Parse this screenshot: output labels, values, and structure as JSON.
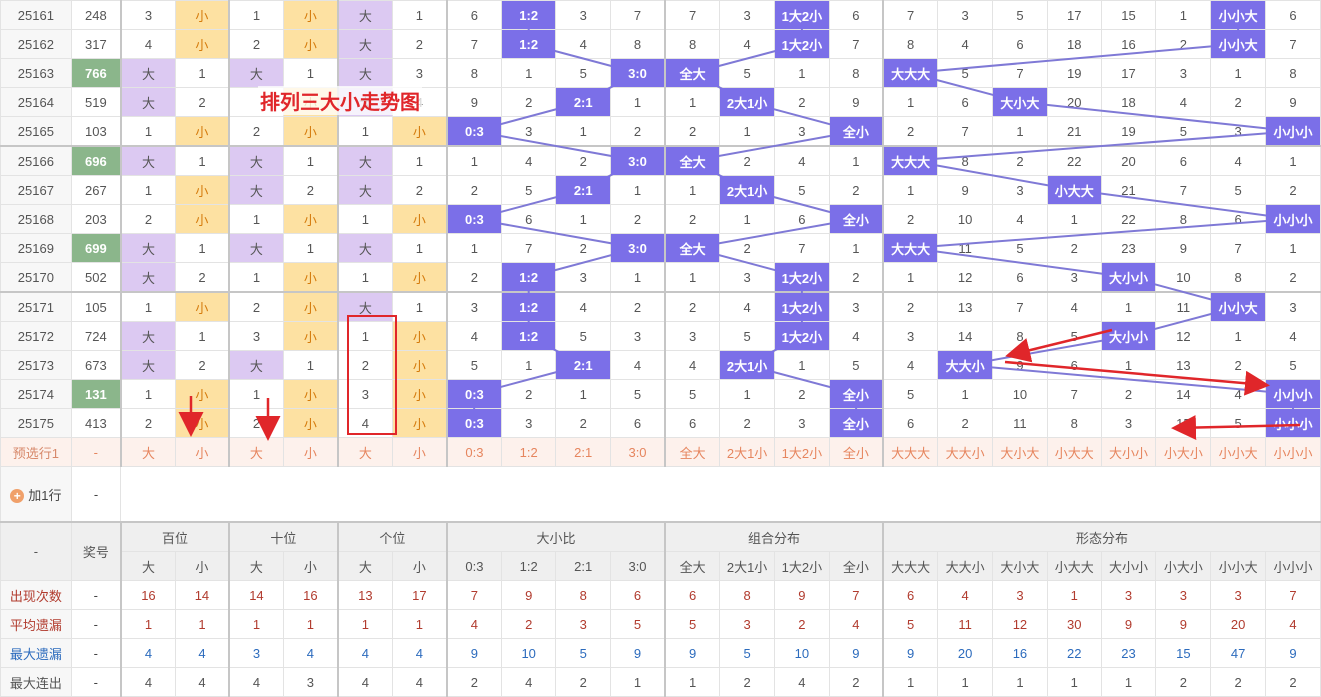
{
  "rows": [
    {
      "issue": "25161",
      "prize": "248",
      "hl": false,
      "cells": [
        "3",
        "小",
        "1",
        "小",
        "大",
        "1",
        "6",
        "1:2",
        "3",
        "7",
        "7",
        "3",
        "1大2小",
        "6",
        "7",
        "3",
        "5",
        "17",
        "15",
        "1",
        "小小大",
        "6"
      ],
      "sel": [
        1,
        3,
        4,
        7,
        12,
        20
      ]
    },
    {
      "issue": "25162",
      "prize": "317",
      "hl": false,
      "cells": [
        "4",
        "小",
        "2",
        "小",
        "大",
        "2",
        "7",
        "1:2",
        "4",
        "8",
        "8",
        "4",
        "1大2小",
        "7",
        "8",
        "4",
        "6",
        "18",
        "16",
        "2",
        "小小大",
        "7"
      ],
      "sel": [
        1,
        3,
        4,
        7,
        12,
        20
      ]
    },
    {
      "issue": "25163",
      "prize": "766",
      "hl": true,
      "cells": [
        "大",
        "1",
        "大",
        "1",
        "大",
        "3",
        "8",
        "1",
        "5",
        "3:0",
        "全大",
        "5",
        "1",
        "8",
        "大大大",
        "5",
        "7",
        "19",
        "17",
        "3",
        "1",
        "8"
      ],
      "sel": [
        0,
        2,
        4,
        9,
        10,
        14
      ]
    },
    {
      "issue": "25164",
      "prize": "519",
      "hl": false,
      "cells": [
        "大",
        "2",
        "",
        "小",
        "大",
        "4",
        "9",
        "2",
        "2:1",
        "1",
        "1",
        "2大1小",
        "2",
        "9",
        "1",
        "6",
        "大小大",
        "20",
        "18",
        "4",
        "2",
        "9"
      ],
      "sel": [
        0,
        3,
        4,
        8,
        11,
        16
      ]
    },
    {
      "issue": "25165",
      "prize": "103",
      "hl": false,
      "cells": [
        "1",
        "小",
        "2",
        "小",
        "1",
        "小",
        "0:3",
        "3",
        "1",
        "2",
        "2",
        "1",
        "3",
        "全小",
        "2",
        "7",
        "1",
        "21",
        "19",
        "5",
        "3",
        "小小小"
      ],
      "sel": [
        1,
        3,
        5,
        6,
        13,
        21
      ]
    },
    {
      "issue": "25166",
      "prize": "696",
      "hl": true,
      "cells": [
        "大",
        "1",
        "大",
        "1",
        "大",
        "1",
        "1",
        "4",
        "2",
        "3:0",
        "全大",
        "2",
        "4",
        "1",
        "大大大",
        "8",
        "2",
        "22",
        "20",
        "6",
        "4",
        "1"
      ],
      "sel": [
        0,
        2,
        4,
        9,
        10,
        14
      ]
    },
    {
      "issue": "25167",
      "prize": "267",
      "hl": false,
      "cells": [
        "1",
        "小",
        "大",
        "2",
        "大",
        "2",
        "2",
        "5",
        "2:1",
        "1",
        "1",
        "2大1小",
        "5",
        "2",
        "1",
        "9",
        "3",
        "小大大",
        "21",
        "7",
        "5",
        "2"
      ],
      "sel": [
        1,
        2,
        4,
        8,
        11,
        17
      ]
    },
    {
      "issue": "25168",
      "prize": "203",
      "hl": false,
      "cells": [
        "2",
        "小",
        "1",
        "小",
        "1",
        "小",
        "0:3",
        "6",
        "1",
        "2",
        "2",
        "1",
        "6",
        "全小",
        "2",
        "10",
        "4",
        "1",
        "22",
        "8",
        "6",
        "小小小"
      ],
      "sel": [
        1,
        3,
        5,
        6,
        13,
        21
      ]
    },
    {
      "issue": "25169",
      "prize": "699",
      "hl": true,
      "cells": [
        "大",
        "1",
        "大",
        "1",
        "大",
        "1",
        "1",
        "7",
        "2",
        "3:0",
        "全大",
        "2",
        "7",
        "1",
        "大大大",
        "11",
        "5",
        "2",
        "23",
        "9",
        "7",
        "1"
      ],
      "sel": [
        0,
        2,
        4,
        9,
        10,
        14
      ]
    },
    {
      "issue": "25170",
      "prize": "502",
      "hl": false,
      "cells": [
        "大",
        "2",
        "1",
        "小",
        "1",
        "小",
        "2",
        "1:2",
        "3",
        "1",
        "1",
        "3",
        "1大2小",
        "2",
        "1",
        "12",
        "6",
        "3",
        "大小小",
        "10",
        "8",
        "2"
      ],
      "sel": [
        0,
        3,
        5,
        7,
        12,
        18
      ]
    },
    {
      "issue": "25171",
      "prize": "105",
      "hl": false,
      "cells": [
        "1",
        "小",
        "2",
        "小",
        "大",
        "1",
        "3",
        "1:2",
        "4",
        "2",
        "2",
        "4",
        "1大2小",
        "3",
        "2",
        "13",
        "7",
        "4",
        "1",
        "11",
        "小小大",
        "3"
      ],
      "sel": [
        1,
        3,
        4,
        7,
        12,
        20
      ]
    },
    {
      "issue": "25172",
      "prize": "724",
      "hl": false,
      "cells": [
        "大",
        "1",
        "3",
        "小",
        "1",
        "小",
        "4",
        "1:2",
        "5",
        "3",
        "3",
        "5",
        "1大2小",
        "4",
        "3",
        "14",
        "8",
        "5",
        "大小小",
        "12",
        "1",
        "4"
      ],
      "sel": [
        0,
        3,
        5,
        7,
        12,
        18
      ]
    },
    {
      "issue": "25173",
      "prize": "673",
      "hl": false,
      "cells": [
        "大",
        "2",
        "大",
        "1",
        "2",
        "小",
        "5",
        "1",
        "2:1",
        "4",
        "4",
        "2大1小",
        "1",
        "5",
        "4",
        "大大小",
        "9",
        "6",
        "1",
        "13",
        "2",
        "5"
      ],
      "sel": [
        0,
        2,
        5,
        8,
        11,
        15
      ]
    },
    {
      "issue": "25174",
      "prize": "131",
      "hl": true,
      "cells": [
        "1",
        "小",
        "1",
        "小",
        "3",
        "小",
        "0:3",
        "2",
        "1",
        "5",
        "5",
        "1",
        "2",
        "全小",
        "5",
        "1",
        "10",
        "7",
        "2",
        "14",
        "4",
        "小小小"
      ],
      "sel": [
        1,
        3,
        5,
        6,
        13,
        21
      ]
    },
    {
      "issue": "25175",
      "prize": "413",
      "hl": false,
      "cells": [
        "2",
        "小",
        "2",
        "小",
        "4",
        "小",
        "0:3",
        "3",
        "2",
        "6",
        "6",
        "2",
        "3",
        "全小",
        "6",
        "2",
        "11",
        "8",
        "3",
        "15",
        "5",
        "小小小"
      ],
      "sel": [
        1,
        3,
        5,
        6,
        13,
        21
      ]
    }
  ],
  "preselect": {
    "label": "预选行1",
    "prize": "-",
    "cells": [
      "大",
      "小",
      "大",
      "小",
      "大",
      "小",
      "0:3",
      "1:2",
      "2:1",
      "3:0",
      "全大",
      "2大1小",
      "1大2小",
      "全小",
      "大大大",
      "大大小",
      "大小大",
      "小大大",
      "大小小",
      "小大小",
      "小小大",
      "小小小"
    ]
  },
  "add_row": {
    "label": "加1行",
    "prize": "-"
  },
  "header": {
    "corner": "-",
    "prize_label": "奖号",
    "groups": [
      "百位",
      "十位",
      "个位",
      "大小比",
      "组合分布",
      "形态分布"
    ],
    "sub": [
      "大",
      "小",
      "大",
      "小",
      "大",
      "小",
      "0:3",
      "1:2",
      "2:1",
      "3:0",
      "全大",
      "2大1小",
      "1大2小",
      "全小",
      "大大大",
      "大大小",
      "大小大",
      "小大大",
      "大小小",
      "小大小",
      "小小大",
      "小小小"
    ]
  },
  "stats": [
    {
      "name": "出现次数",
      "prize": "-",
      "values": [
        "16",
        "14",
        "14",
        "16",
        "13",
        "17",
        "7",
        "9",
        "8",
        "6",
        "6",
        "8",
        "9",
        "7",
        "6",
        "4",
        "3",
        "1",
        "3",
        "3",
        "3",
        "7"
      ]
    },
    {
      "name": "平均遗漏",
      "prize": "-",
      "values": [
        "1",
        "1",
        "1",
        "1",
        "1",
        "1",
        "4",
        "2",
        "3",
        "5",
        "5",
        "3",
        "2",
        "4",
        "5",
        "11",
        "12",
        "30",
        "9",
        "9",
        "20",
        "4"
      ]
    },
    {
      "name": "最大遗漏",
      "prize": "-",
      "values": [
        "4",
        "4",
        "3",
        "4",
        "4",
        "4",
        "9",
        "10",
        "5",
        "9",
        "9",
        "5",
        "10",
        "9",
        "9",
        "20",
        "16",
        "22",
        "23",
        "15",
        "47",
        "9"
      ]
    },
    {
      "name": "最大连出",
      "prize": "-",
      "values": [
        "4",
        "4",
        "4",
        "3",
        "4",
        "4",
        "2",
        "4",
        "2",
        "1",
        "1",
        "2",
        "4",
        "2",
        "1",
        "1",
        "1",
        "1",
        "1",
        "2",
        "2",
        "2"
      ]
    }
  ],
  "annotation": {
    "title": "排列三大小走势图"
  },
  "colors": {
    "big": "#dcc9f2",
    "small": "#fde1a2",
    "selected": "#7b6fe8",
    "prize_highlight": "#8bb68b",
    "trend_line": "#7f79d6",
    "annotation": "#e0262a"
  }
}
